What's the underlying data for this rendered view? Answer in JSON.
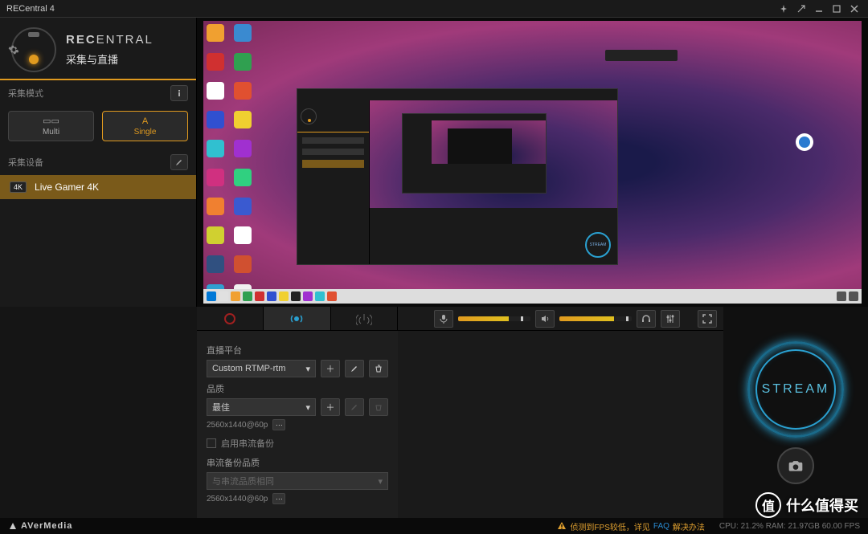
{
  "titlebar": {
    "title": "RECentral 4"
  },
  "header": {
    "brand_prefix": "REC",
    "brand_suffix": "ENTRAL",
    "subtitle": "采集与直播"
  },
  "capture_mode": {
    "label": "采集模式",
    "multi": "Multi",
    "single": "Single"
  },
  "capture_device": {
    "label": "采集设备",
    "badge": "4K",
    "name": "Live Gamer 4K"
  },
  "stream_panel": {
    "platform_label": "直播平台",
    "platform_value": "Custom RTMP-rtm",
    "quality_label": "品质",
    "quality_value": "最佳",
    "quality_res": "2560x1440@60p",
    "backup_checkbox": "启用串流备份",
    "backup_quality_label": "串流备份品质",
    "backup_quality_value": "与串流品质相同",
    "backup_res": "2560x1440@60p"
  },
  "stream_button": {
    "label": "STREAM"
  },
  "statusbar": {
    "brand": "AVerMedia",
    "warning_prefix": "侦测到FPS较低，详见",
    "warning_link": "FAQ",
    "warning_suffix": "解决办法",
    "stats": "CPU: 21.2%  RAM: 21.97GB  60.00 FPS"
  },
  "watermark": {
    "char": "值",
    "text": "什么值得买"
  },
  "colors": {
    "accent": "#e09a1f",
    "stream": "#2aa0d0"
  }
}
